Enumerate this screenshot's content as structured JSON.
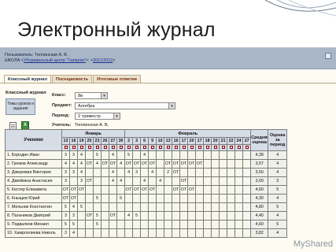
{
  "slide": {
    "title": "Электронный журнал"
  },
  "header": {
    "user_line": "Пользователь: Теплинская А. В.",
    "school_prefix": "ШКОЛА <",
    "school_link": "Уборевальный центр \"Газпром\"",
    "school_mid": ">: <",
    "year_link": "2011/2012",
    "school_suffix": ">"
  },
  "tabs": [
    {
      "label": "Классный журнал",
      "active": true
    },
    {
      "label": "Посещаемость",
      "active": false
    },
    {
      "label": "Итоговые отметки",
      "active": false
    }
  ],
  "panel": {
    "title": "Классный журнал",
    "topics_button": "Темы уроков и задания",
    "excel_icon_letter": "X"
  },
  "filters": {
    "class_label": "Класс:",
    "class_value": "8в",
    "subject_label": "Предмет:",
    "subject_value": "Алгебра",
    "period_label": "Период:",
    "period_value": "2 триместр",
    "teacher_label": "Учитель:",
    "teacher_value": "Теплинская А. В."
  },
  "grid": {
    "students_header": "Ученики",
    "months": [
      {
        "name": "Январь",
        "span": 8
      },
      {
        "name": "Февраль",
        "span": 16
      }
    ],
    "days": [
      "13",
      "16",
      "19",
      "20",
      "23",
      "26",
      "27",
      "30",
      "2",
      "3",
      "6",
      "9",
      "10",
      "13",
      "16",
      "17",
      "20",
      "17",
      "18",
      "20",
      "21",
      "22",
      "24",
      "27"
    ],
    "avg_header": "Средняя оценка",
    "final_header": "Оценка за период",
    "rows": [
      {
        "name": "1. Бородин Иван",
        "marks": [
          "3",
          "3",
          "4",
          "",
          "5",
          "",
          "4",
          "",
          "5",
          "",
          "4",
          "",
          "",
          "",
          "",
          "",
          "",
          "",
          "",
          "",
          "",
          "",
          "",
          ""
        ],
        "avg": "4,28",
        "final": "4"
      },
      {
        "name": "2. Громов Александр",
        "marks": [
          "4",
          "4",
          "4",
          "ОТ",
          "4",
          "ОТ",
          "ОТ",
          "4",
          "ОТ",
          "ОТ",
          "ОТ",
          "ОТ",
          "",
          "ОТ",
          "ОТ",
          "ОТ",
          "ОТ",
          "ОТ",
          "",
          "",
          "",
          "",
          "",
          ""
        ],
        "avg": "3,57",
        "final": "4"
      },
      {
        "name": "3. Джеремая Виктория",
        "marks": [
          "3",
          "3",
          "4",
          "",
          "",
          "",
          "4",
          "",
          "4",
          "3",
          "",
          "4",
          "",
          "2",
          "ОТ",
          "",
          "",
          "",
          "",
          "",
          "",
          "",
          "",
          ""
        ],
        "avg": "3,50",
        "final": "4"
      },
      {
        "name": "4. Дмейкина Анастасия",
        "marks": [
          "3",
          "",
          "3",
          "ОТ",
          "",
          "",
          "4",
          "4",
          "",
          "",
          "4",
          "",
          "4",
          "",
          "",
          "ОТ",
          "",
          "",
          "",
          "",
          "",
          "",
          "",
          ""
        ],
        "avg": "3,09",
        "final": "3"
      },
      {
        "name": "5. Кестер Елизавета",
        "marks": [
          "ОТ",
          "ОТ",
          "ОТ",
          "",
          "",
          "",
          "",
          "",
          "ОТ",
          "ОТ",
          "ОТ",
          "ОТ",
          "",
          "",
          "ОТ",
          "ОТ",
          "ОТ",
          "",
          "",
          "",
          "",
          "",
          "",
          ""
        ],
        "avg": "4,60",
        "final": "5"
      },
      {
        "name": "6. Кныщев Юрий",
        "marks": [
          "ОТ",
          "ОТ",
          "",
          "",
          "5",
          "",
          "",
          "5",
          "",
          "",
          "",
          "",
          "",
          "",
          "",
          "",
          "",
          "",
          "",
          "",
          "",
          "",
          "",
          ""
        ],
        "avg": "4,30",
        "final": "4"
      },
      {
        "name": "7. Мельник Константин",
        "marks": [
          "5",
          "4",
          "5",
          "",
          "",
          "",
          "",
          "",
          "",
          "",
          "",
          "",
          "",
          "",
          "",
          "",
          "",
          "",
          "",
          "",
          "",
          "",
          "",
          ""
        ],
        "avg": "4,80",
        "final": "5"
      },
      {
        "name": "8. Пальчиков Дмитрий",
        "marks": [
          "3",
          "3",
          "",
          "ОТ",
          "5",
          "",
          "ОТ",
          "",
          "4",
          "5",
          "",
          "",
          "",
          "",
          "",
          "",
          "",
          "",
          "",
          "",
          "",
          "",
          "",
          ""
        ],
        "avg": "4,40",
        "final": "4"
      },
      {
        "name": "9. Подвалков Михаил",
        "marks": [
          "5",
          "5",
          "",
          "",
          "5",
          "",
          "",
          "",
          "",
          "",
          "",
          "",
          "",
          "",
          "",
          "",
          "",
          "",
          "",
          "",
          "",
          "",
          "",
          ""
        ],
        "avg": "4,60",
        "final": "5"
      },
      {
        "name": "10. Хамрлолиева Николь",
        "marks": [
          "3",
          "4",
          "",
          "",
          "",
          "",
          "",
          "",
          "",
          "",
          "",
          "",
          "",
          "",
          "",
          "",
          "",
          "",
          "",
          "",
          "",
          "",
          "",
          ""
        ],
        "avg": "3,82",
        "final": "4"
      }
    ]
  },
  "watermark": {
    "brand": "MyShared"
  }
}
